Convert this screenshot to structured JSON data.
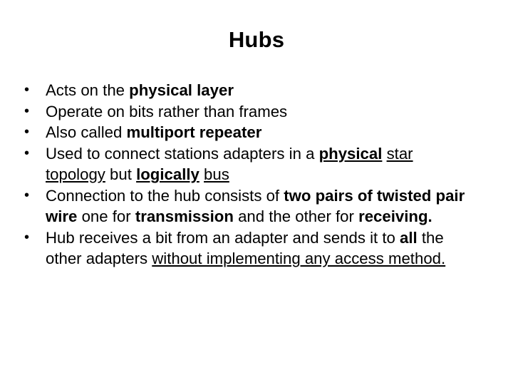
{
  "slide": {
    "title": "Hubs",
    "bullets": [
      {
        "runs": [
          {
            "text": "Acts on the ",
            "bold": false,
            "underline": false
          },
          {
            "text": "physical layer",
            "bold": true,
            "underline": false
          }
        ]
      },
      {
        "runs": [
          {
            "text": "Operate on bits rather than frames",
            "bold": false,
            "underline": false
          }
        ]
      },
      {
        "runs": [
          {
            "text": "Also called  ",
            "bold": false,
            "underline": false
          },
          {
            "text": "multiport repeater",
            "bold": true,
            "underline": false
          }
        ]
      },
      {
        "runs": [
          {
            "text": "Used to connect stations adapters in a ",
            "bold": false,
            "underline": false
          },
          {
            "text": "physical",
            "bold": true,
            "underline": true
          },
          {
            "text": " ",
            "bold": false,
            "underline": false
          },
          {
            "text": "star topology",
            "bold": false,
            "underline": true
          },
          {
            "text": " but ",
            "bold": false,
            "underline": false
          },
          {
            "text": "logically",
            "bold": true,
            "underline": true
          },
          {
            "text": " ",
            "bold": false,
            "underline": false
          },
          {
            "text": "bus",
            "bold": false,
            "underline": true
          }
        ]
      },
      {
        "runs": [
          {
            "text": "Connection to the hub consists of ",
            "bold": false,
            "underline": false
          },
          {
            "text": "two pairs of twisted pair wire",
            "bold": true,
            "underline": false
          },
          {
            "text": " one for ",
            "bold": false,
            "underline": false
          },
          {
            "text": "transmission",
            "bold": true,
            "underline": false
          },
          {
            "text": " and the other for ",
            "bold": false,
            "underline": false
          },
          {
            "text": "receiving.",
            "bold": true,
            "underline": false
          }
        ]
      },
      {
        "runs": [
          {
            "text": "Hub receives a bit from an adapter and sends it to ",
            "bold": false,
            "underline": false
          },
          {
            "text": "all",
            "bold": true,
            "underline": false
          },
          {
            "text": " the other adapters ",
            "bold": false,
            "underline": false
          },
          {
            "text": "without implementing any access method.",
            "bold": false,
            "underline": true
          }
        ]
      }
    ],
    "bullet_glyph": "•"
  }
}
